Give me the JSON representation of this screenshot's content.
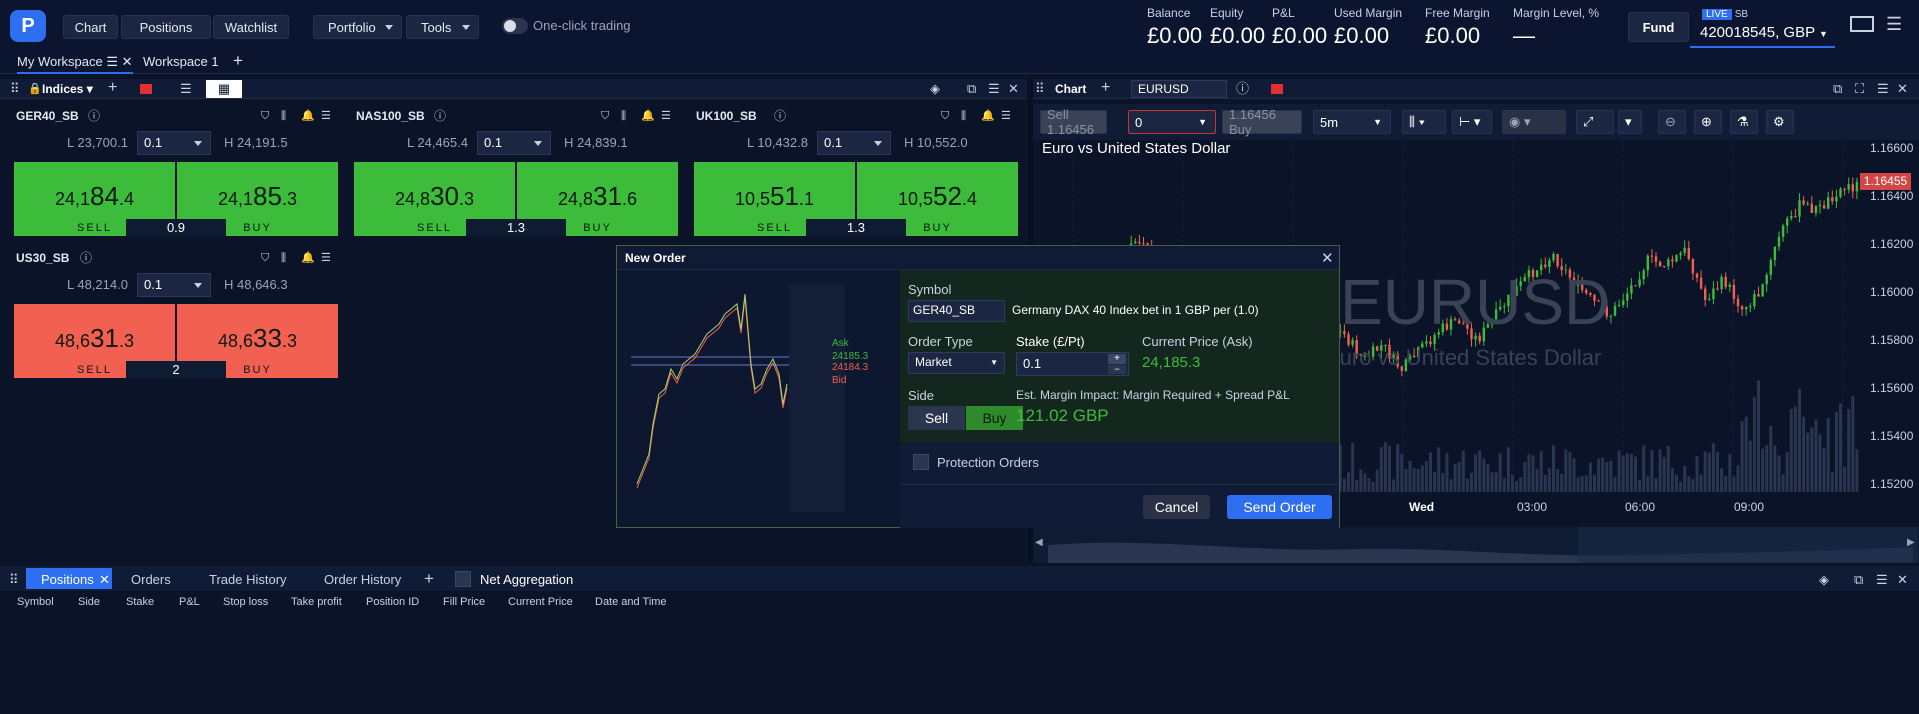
{
  "top": {
    "logo": "P",
    "buttons": [
      "Chart",
      "Positions",
      "Watchlist"
    ],
    "dropdowns": [
      "Portfolio",
      "Tools"
    ],
    "one_click": "One-click trading",
    "stats": [
      {
        "label": "Balance",
        "value": "£0.00"
      },
      {
        "label": "Equity",
        "value": "£0.00"
      },
      {
        "label": "P&L",
        "value": "£0.00"
      },
      {
        "label": "Used Margin",
        "value": "£0.00"
      },
      {
        "label": "Free Margin",
        "value": "£0.00"
      },
      {
        "label": "Margin Level, %",
        "value": "—"
      }
    ],
    "fund": "Fund",
    "live": "LIVE",
    "sb": "SB",
    "account": "420018545, GBP"
  },
  "workspaces": [
    "My Workspace",
    "Workspace 1"
  ],
  "watchlist": {
    "title": "Indices",
    "cards": [
      {
        "symbol": "GER40_SB",
        "low": "L 23,700.1",
        "high": "H 24,191.5",
        "lot": "0.1",
        "sell_a": "24,1",
        "sell_b": "84",
        "sell_c": ".4",
        "buy_a": "24,1",
        "buy_b": "85",
        "buy_c": ".3",
        "spread": "0.9",
        "sell": "SELL",
        "buy": "BUY"
      },
      {
        "symbol": "NAS100_SB",
        "low": "L 24,465.4",
        "high": "H 24,839.1",
        "lot": "0.1",
        "sell_a": "24,8",
        "sell_b": "30",
        "sell_c": ".3",
        "buy_a": "24,8",
        "buy_b": "31",
        "buy_c": ".6",
        "spread": "1.3",
        "sell": "SELL",
        "buy": "BUY"
      },
      {
        "symbol": "UK100_SB",
        "low": "L 10,432.8",
        "high": "H 10,552.0",
        "lot": "0.1",
        "sell_a": "10,5",
        "sell_b": "51",
        "sell_c": ".1",
        "buy_a": "10,5",
        "buy_b": "52",
        "buy_c": ".4",
        "spread": "1.3",
        "sell": "SELL",
        "buy": "BUY"
      },
      {
        "symbol": "US30_SB",
        "low": "L 48,214.0",
        "high": "H 48,646.3",
        "lot": "0.1",
        "sell_a": "48,6",
        "sell_b": "31",
        "sell_c": ".3",
        "buy_a": "48,6",
        "buy_b": "33",
        "buy_c": ".3",
        "spread": "2",
        "sell": "SELL",
        "buy": "BUY"
      }
    ]
  },
  "chart": {
    "title": "Chart",
    "symbol": "EURUSD",
    "sell": "Sell 1.16456",
    "qty": "0",
    "buy": "1.16456 Buy",
    "tf": "5m",
    "name": "Euro vs United States Dollar",
    "watermark": "EURUSD",
    "watermark_sub": "Euro vs United States Dollar",
    "current": "1.16455",
    "yticks": [
      "1.16600",
      "1.16400",
      "1.16200",
      "1.16000",
      "1.15800",
      "1.15600",
      "1.15400",
      "1.15200"
    ],
    "xticks": [
      "Wed",
      "03:00",
      "06:00",
      "09:00"
    ]
  },
  "order": {
    "title": "New Order",
    "symbol_label": "Symbol",
    "symbol": "GER40_SB",
    "description": "Germany DAX 40 Index bet in 1 GBP per (1.0)",
    "type_label": "Order Type",
    "type": "Market",
    "stake_label": "Stake (£/Pt)",
    "stake": "0.1",
    "price_label": "Current Price (Ask)",
    "price": "24,185.3",
    "side_label": "Side",
    "sell": "Sell",
    "buy": "Buy",
    "margin_label": "Est. Margin Impact: Margin Required + Spread P&L",
    "margin": "121.02 GBP",
    "protection": "Protection Orders",
    "cancel": "Cancel",
    "send": "Send Order",
    "ask_label": "Ask",
    "ask": "24185.3",
    "bid": "24184.3",
    "bid_label": "Bid"
  },
  "bottom": {
    "tabs": [
      "Positions",
      "Orders",
      "Trade History",
      "Order History"
    ],
    "net": "Net Aggregation",
    "columns": [
      "Symbol",
      "Side",
      "Stake",
      "P&L",
      "Stop loss",
      "Take profit",
      "Position ID",
      "Fill Price",
      "Current Price",
      "Date and Time"
    ]
  },
  "colors": {
    "green": "#3dbb3a",
    "red": "#f26052",
    "blue": "#2d6ff0"
  }
}
